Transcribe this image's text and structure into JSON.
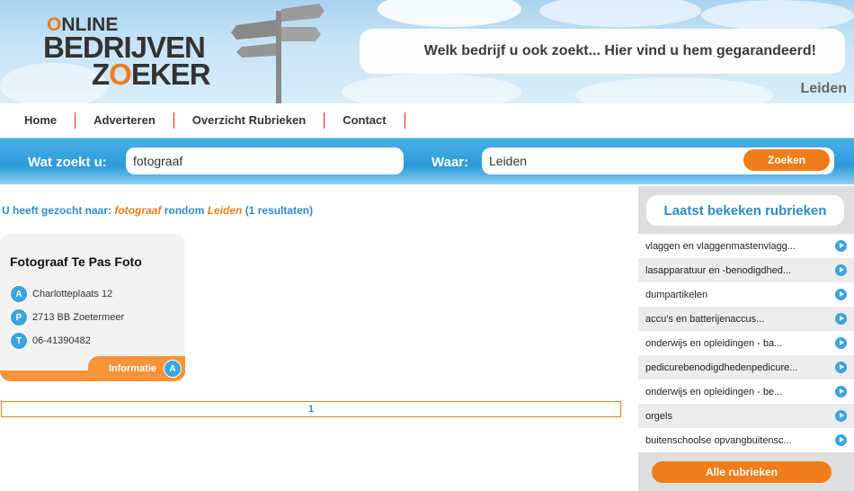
{
  "header": {
    "logo": {
      "line1_prefix": "O",
      "line1_rest": "NLINE",
      "line2": "BEDRIJVEN",
      "line3_a": "Z",
      "line3_o": "O",
      "line3_b": "EKER"
    },
    "slogan": "Welk bedrijf u ook zoekt... Hier vind u hem gegarandeerd!",
    "city": "Leiden"
  },
  "nav": {
    "items": [
      "Home",
      "Adverteren",
      "Overzicht Rubrieken",
      "Contact"
    ]
  },
  "search": {
    "what_label": "Wat zoekt u:",
    "what_value": "fotograaf",
    "where_label": "Waar:",
    "where_value": "Leiden",
    "button_label": "Zoeken"
  },
  "results": {
    "prefix": "U heeft gezocht naar:",
    "term": "fotograaf",
    "middle": "rondom",
    "place": "Leiden",
    "count": "(1 resultaten)"
  },
  "card": {
    "title": "Fotograaf Te Pas Foto",
    "rows": [
      {
        "badge": "A",
        "text": "Charlotteplaats 12"
      },
      {
        "badge": "P",
        "text": "2713 BB Zoetermeer"
      },
      {
        "badge": "T",
        "text": "06-41390482"
      }
    ],
    "footer_label": "Informatie",
    "footer_badge": "A"
  },
  "pager": {
    "current": "1"
  },
  "sidebar": {
    "title": "Laatst bekeken rubrieken",
    "items": [
      "vlaggen en vlaggenmastenvlagg...",
      "lasapparatuur en -benodigdhed...",
      "dumpartikelen",
      "accu's en batterijenaccus...",
      "onderwijs en opleidingen - ba...",
      "pedicurebenodigdhedenpedicure...",
      "onderwijs en opleidingen - be...",
      "orgels",
      "buitenschoolse opvangbuitensc..."
    ],
    "button_label": "Alle rubrieken"
  },
  "colors": {
    "accent_orange": "#f07d1a",
    "accent_blue": "#2a8ccf",
    "search_bar_blue": "#2a9bd9"
  }
}
